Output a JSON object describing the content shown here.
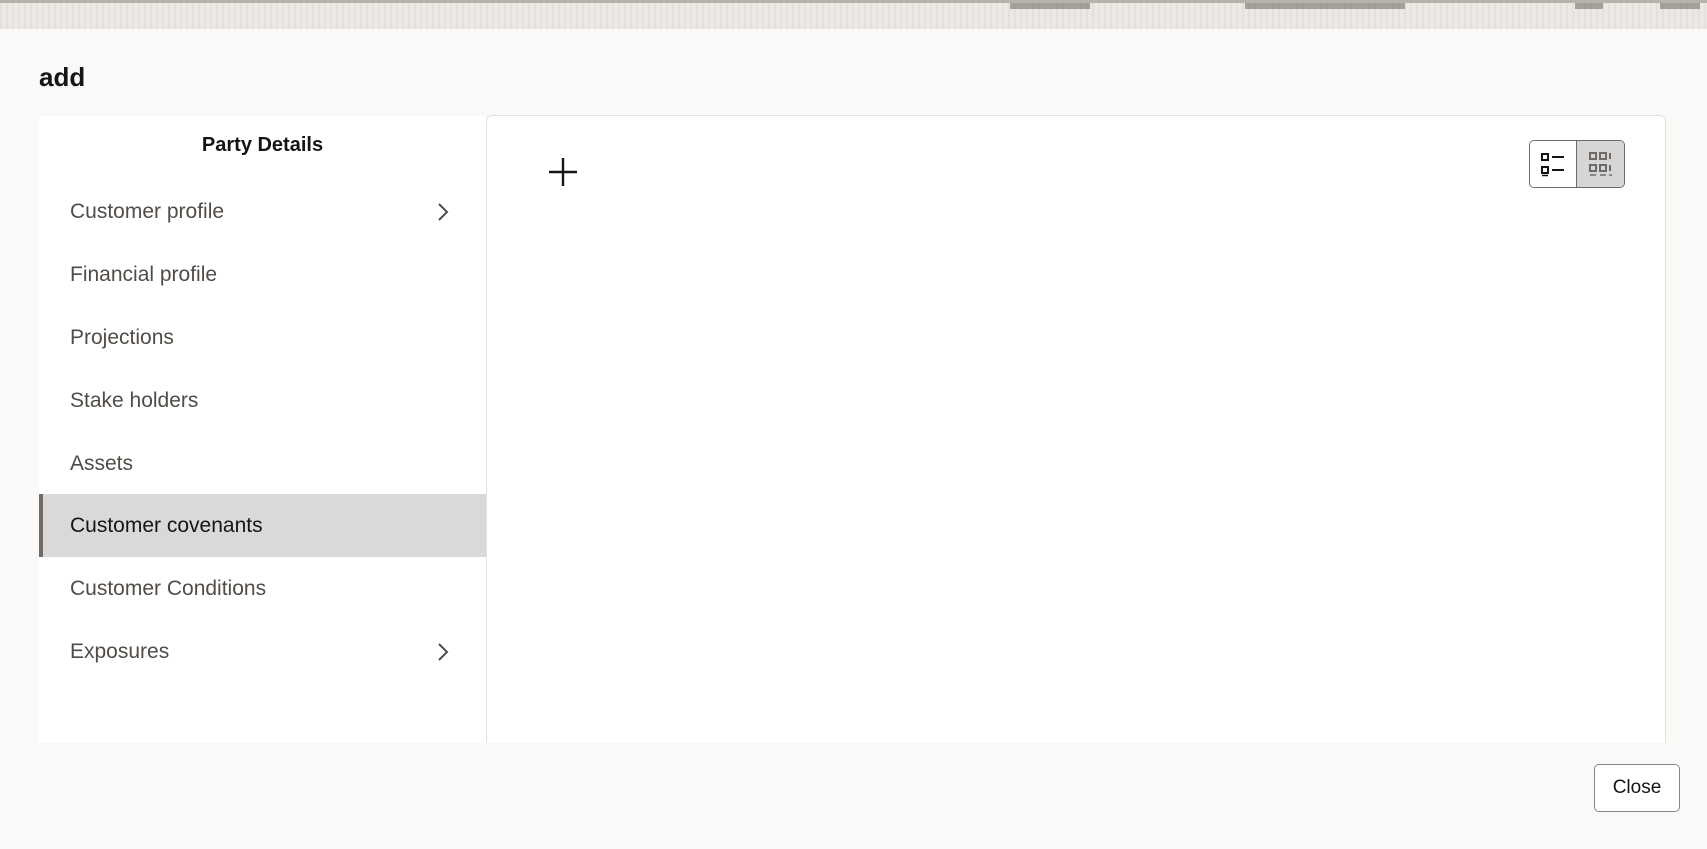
{
  "dialog": {
    "title": "add"
  },
  "nav": {
    "header": "Party Details",
    "items": [
      {
        "label": "Customer profile",
        "icon": "chevron-right-icon"
      },
      {
        "label": "Financial profile"
      },
      {
        "label": "Projections"
      },
      {
        "label": "Stake holders"
      },
      {
        "label": "Assets"
      },
      {
        "label": "Customer covenants",
        "selected": true
      },
      {
        "label": "Customer Conditions"
      },
      {
        "label": "Exposures",
        "icon": "chevron-right-icon"
      }
    ]
  },
  "content": {
    "add_icon": "plus-icon",
    "view_toggle": {
      "options": [
        "list-view-icon",
        "grid-view-icon"
      ],
      "selected": "grid-view-icon"
    }
  },
  "footer": {
    "close_label": "Close"
  },
  "colors": {
    "selected_bg": "#d9d9d9",
    "selected_border": "#6f6a66",
    "nav_text": "#514c47",
    "page_bg": "#faf9f8"
  }
}
